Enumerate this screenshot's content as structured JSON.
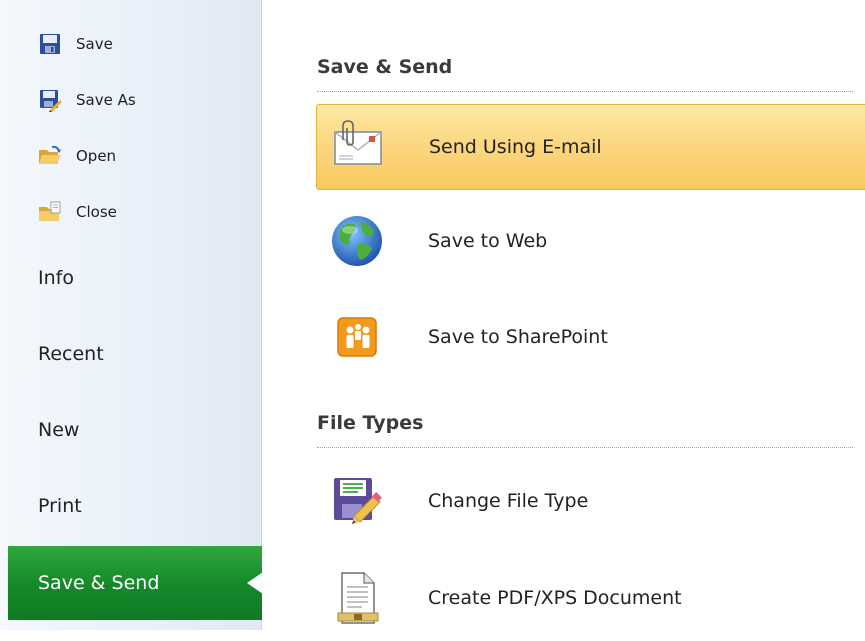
{
  "nav": {
    "commands": [
      {
        "label": "Save",
        "icon": "save-icon"
      },
      {
        "label": "Save As",
        "icon": "save-as-icon"
      },
      {
        "label": "Open",
        "icon": "open-folder-icon"
      },
      {
        "label": "Close",
        "icon": "close-folder-icon"
      }
    ],
    "tabs": [
      "Info",
      "Recent",
      "New",
      "Print"
    ],
    "active_tab": "Save & Send"
  },
  "main": {
    "section1": {
      "title": "Save & Send",
      "options": [
        {
          "label": "Send Using E-mail",
          "icon": "email-icon",
          "selected": true
        },
        {
          "label": "Save to Web",
          "icon": "globe-icon"
        },
        {
          "label": "Save to SharePoint",
          "icon": "sharepoint-icon"
        }
      ]
    },
    "section2": {
      "title": "File Types",
      "options": [
        {
          "label": "Change File Type",
          "icon": "change-file-type-icon"
        },
        {
          "label": "Create PDF/XPS Document",
          "icon": "pdf-document-icon"
        }
      ]
    }
  },
  "colors": {
    "active_tab": "#15872a",
    "selected_option": "#fcd67e",
    "nav_background": "#e6eef8"
  }
}
